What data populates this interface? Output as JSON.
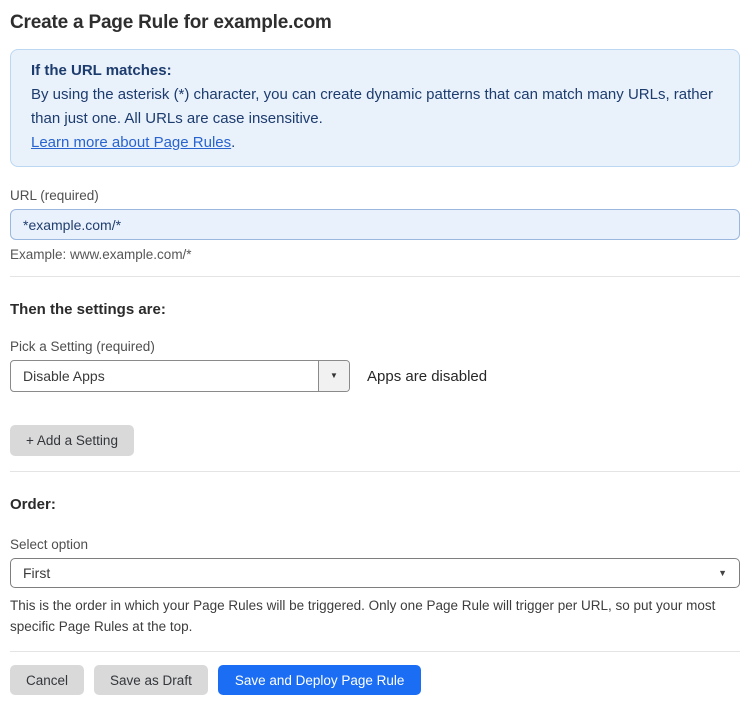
{
  "page": {
    "title": "Create a Page Rule for example.com"
  },
  "info_box": {
    "heading": "If the URL matches:",
    "body": "By using the asterisk (*) character, you can create dynamic patterns that can match many URLs, rather than just one. All URLs are case insensitive.",
    "link_label": "Learn more about Page Rules",
    "link_suffix": "."
  },
  "url_field": {
    "label": "URL (required)",
    "value": "*example.com/*",
    "helper": "Example: www.example.com/*"
  },
  "settings_section": {
    "heading": "Then the settings are:",
    "setting_label": "Pick a Setting (required)",
    "setting_value": "Disable Apps",
    "setting_status": "Apps are disabled",
    "add_setting_label": "+ Add a Setting"
  },
  "order_section": {
    "heading": "Order:",
    "label": "Select option",
    "value": "First",
    "helper": "This is the order in which your Page Rules will be triggered. Only one Page Rule will trigger per URL, so put your most specific Page Rules at the top."
  },
  "footer": {
    "cancel_label": "Cancel",
    "save_draft_label": "Save as Draft",
    "save_deploy_label": "Save and Deploy Page Rule"
  },
  "icons": {
    "caret_down": "▼"
  },
  "colors": {
    "info_bg": "#e9f1fb",
    "info_border": "#bcd7f2",
    "info_text": "#1d3c6e",
    "link": "#2864cf",
    "input_bg": "#e9f1fc",
    "input_border": "#9cb7dd",
    "primary_button": "#1b6ef3",
    "gray_button": "#d9d9d9"
  }
}
